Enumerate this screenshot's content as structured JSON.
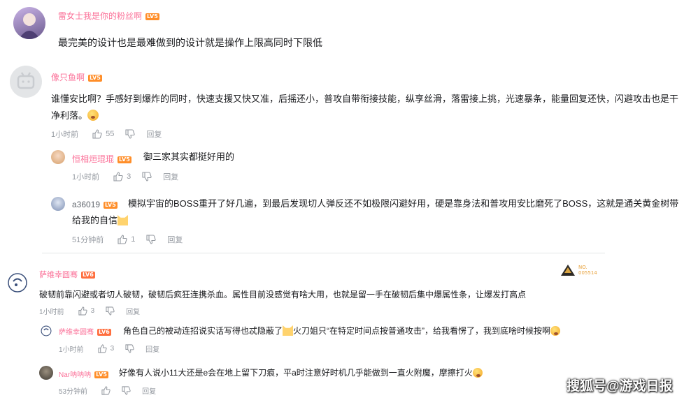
{
  "c1": {
    "user": "雷女士我是你的粉丝啊",
    "level": "LV5",
    "text": "最完美的设计也是最难做到的设计就是操作上限高同时下限低"
  },
  "c2": {
    "user": "像只鱼啊",
    "level": "LV5",
    "text": "谁懂安比啊？手感好到爆炸的同时，快速支援又快又准，后摇还小，普攻自带衔接技能，纵享丝滑，落雷接上挑，光速暴条，能量回复还快，闪避攻击也是干净利落。",
    "time": "1小时前",
    "likes": "55",
    "reply": "回复"
  },
  "r1": {
    "user": "恒相烜琨琨",
    "level": "LV5",
    "text": "御三家其实都挺好用的",
    "time": "1小时前",
    "likes": "3",
    "reply": "回复"
  },
  "r2": {
    "user": "a36019",
    "level": "LV5",
    "text": "模拟宇宙的BOSS重开了好几遍，到最后发现切人弹反还不如极限闪避好用，硬是靠身法和普攻用安比磨死了BOSS，这就是通关黄金树带给我的自信",
    "time": "51分钟前",
    "likes": "1",
    "reply": "回复"
  },
  "c3": {
    "user": "萨维幸圆骞",
    "level": "LV6",
    "badge_no": "NO.",
    "badge_num": "005514",
    "text": "破韧前靠闪避或者切人破韧，破韧后疯狂连携杀血。属性目前没感觉有啥大用，也就是留一手在破韧后集中爆属性条，让爆发打高点",
    "time": "1小时前",
    "likes": "3",
    "reply": "回复"
  },
  "r3": {
    "user": "萨维幸圆骞",
    "level": "LV6",
    "text1": "角色自己的被动连招说实话写得也忒隐蔽了",
    "text2": "火刀姐只“在特定时间点按普通攻击”，给我看愣了，我到底啥时候按啊",
    "time": "1小时前",
    "likes": "3",
    "reply": "回复"
  },
  "r4": {
    "user": "Nar呐呐呐",
    "level": "LV5",
    "text": "好像有人说小11大还是e会在地上留下刀痕，平a时注意好时机几乎能做到一直火附魔，摩擦打火",
    "time": "53分钟前",
    "likes": "",
    "reply": "回复"
  },
  "watermark": "搜狐号@游戏日报",
  "colors": {
    "username": "#fb7299",
    "meta": "#9499a0",
    "level": "#ff8e29"
  }
}
